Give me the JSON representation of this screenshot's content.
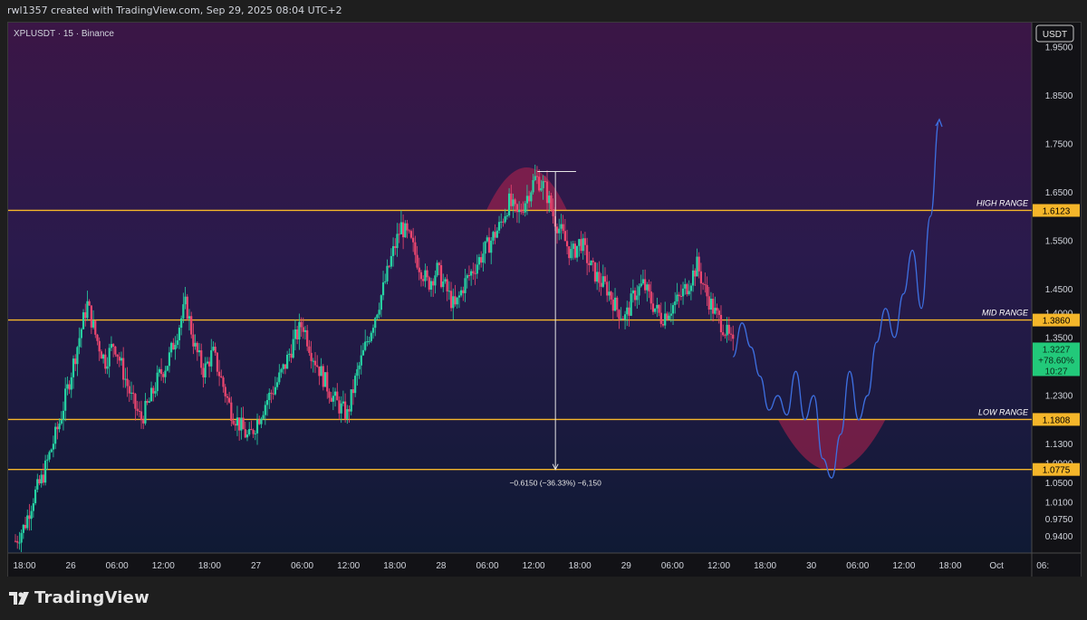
{
  "header": {
    "credit": "rwl1357 created with TradingView.com, Sep 29, 2025 08:04 UTC+2"
  },
  "brand": {
    "name": "TradingView"
  },
  "colors": {
    "level_line": "#f5b62a",
    "candle_up": "#26d4a4",
    "candle_down": "#ef4770",
    "projection": "#3d6fe0",
    "highlight": "#b8234f",
    "current_price_bg": "#22c97a"
  },
  "chart_data": {
    "type": "candlestick",
    "symbol_label": "XPLUSDT · 15 · Binance",
    "currency": "USDT",
    "ylim": [
      0.905,
      2.0
    ],
    "y_ticks": [
      "1.9500",
      "1.8500",
      "1.7500",
      "1.6500",
      "1.5500",
      "1.4500",
      "1.4000",
      "1.3500",
      "1.2300",
      "1.1800",
      "1.1300",
      "1.0900",
      "1.0500",
      "1.0100",
      "0.9750",
      "0.9400"
    ],
    "x_ticks": [
      "18:00",
      "26",
      "06:00",
      "12:00",
      "18:00",
      "27",
      "06:00",
      "12:00",
      "18:00",
      "28",
      "06:00",
      "12:00",
      "18:00",
      "29",
      "06:00",
      "12:00",
      "18:00",
      "30",
      "06:00",
      "12:00",
      "18:00",
      "Oct",
      "06:"
    ],
    "levels": [
      {
        "name": "HIGH RANGE",
        "value": 1.6123,
        "label": "1.6123"
      },
      {
        "name": "MID RANGE",
        "value": 1.386,
        "label": "1.3860"
      },
      {
        "name": "LOW RANGE",
        "value": 1.1808,
        "label": "1.1808"
      },
      {
        "name": "",
        "value": 1.0775,
        "label": "1.0775"
      }
    ],
    "current_price": {
      "value": 1.3227,
      "price": "1.3227",
      "change": "+78.60%",
      "countdown": "10:27"
    },
    "measure": {
      "from": 1.6925,
      "to": 1.0775,
      "label": "−0.6150 (−36.33%) −6,150"
    },
    "price_path": [
      [
        0,
        0.93
      ],
      [
        1,
        0.96
      ],
      [
        2,
        1.02
      ],
      [
        3,
        1.06
      ],
      [
        4,
        1.12
      ],
      [
        5,
        1.18
      ],
      [
        6,
        1.26
      ],
      [
        7,
        1.34
      ],
      [
        8,
        1.42
      ],
      [
        9,
        1.35
      ],
      [
        10,
        1.3
      ],
      [
        11,
        1.34
      ],
      [
        12,
        1.28
      ],
      [
        13,
        1.22
      ],
      [
        14,
        1.18
      ],
      [
        15,
        1.22
      ],
      [
        16,
        1.27
      ],
      [
        17,
        1.3
      ],
      [
        18,
        1.36
      ],
      [
        19,
        1.42
      ],
      [
        20,
        1.33
      ],
      [
        21,
        1.28
      ],
      [
        22,
        1.32
      ],
      [
        23,
        1.26
      ],
      [
        24,
        1.2
      ],
      [
        25,
        1.17
      ],
      [
        26,
        1.14
      ],
      [
        27,
        1.18
      ],
      [
        28,
        1.22
      ],
      [
        29,
        1.25
      ],
      [
        30,
        1.29
      ],
      [
        31,
        1.34
      ],
      [
        32,
        1.38
      ],
      [
        33,
        1.32
      ],
      [
        34,
        1.28
      ],
      [
        35,
        1.24
      ],
      [
        36,
        1.21
      ],
      [
        37,
        1.19
      ],
      [
        38,
        1.27
      ],
      [
        39,
        1.33
      ],
      [
        40,
        1.39
      ],
      [
        41,
        1.45
      ],
      [
        42,
        1.52
      ],
      [
        43,
        1.58
      ],
      [
        44,
        1.55
      ],
      [
        45,
        1.5
      ],
      [
        46,
        1.46
      ],
      [
        47,
        1.49
      ],
      [
        48,
        1.45
      ],
      [
        49,
        1.41
      ],
      [
        50,
        1.46
      ],
      [
        51,
        1.49
      ],
      [
        52,
        1.52
      ],
      [
        53,
        1.55
      ],
      [
        54,
        1.58
      ],
      [
        55,
        1.63
      ],
      [
        56,
        1.6
      ],
      [
        57,
        1.64
      ],
      [
        58,
        1.68
      ],
      [
        59,
        1.66
      ],
      [
        60,
        1.6
      ],
      [
        61,
        1.56
      ],
      [
        62,
        1.52
      ],
      [
        63,
        1.55
      ],
      [
        64,
        1.5
      ],
      [
        65,
        1.47
      ],
      [
        66,
        1.45
      ],
      [
        67,
        1.41
      ],
      [
        68,
        1.39
      ],
      [
        69,
        1.44
      ],
      [
        70,
        1.46
      ],
      [
        71,
        1.42
      ],
      [
        72,
        1.39
      ],
      [
        73,
        1.41
      ],
      [
        74,
        1.43
      ],
      [
        75,
        1.46
      ],
      [
        76,
        1.5
      ],
      [
        77,
        1.44
      ],
      [
        78,
        1.4
      ],
      [
        79,
        1.37
      ],
      [
        80,
        1.33
      ]
    ],
    "projection_path": [
      [
        80,
        1.31
      ],
      [
        81,
        1.38
      ],
      [
        82,
        1.33
      ],
      [
        83,
        1.27
      ],
      [
        84,
        1.2
      ],
      [
        85,
        1.23
      ],
      [
        86,
        1.19
      ],
      [
        87,
        1.28
      ],
      [
        88,
        1.18
      ],
      [
        89,
        1.23
      ],
      [
        90,
        1.1
      ],
      [
        91,
        1.06
      ],
      [
        92,
        1.15
      ],
      [
        93,
        1.28
      ],
      [
        94,
        1.18
      ],
      [
        95,
        1.23
      ],
      [
        96,
        1.34
      ],
      [
        97,
        1.41
      ],
      [
        98,
        1.35
      ],
      [
        99,
        1.44
      ],
      [
        100,
        1.53
      ],
      [
        101,
        1.41
      ],
      [
        102,
        1.6
      ],
      [
        103,
        1.8
      ]
    ]
  }
}
